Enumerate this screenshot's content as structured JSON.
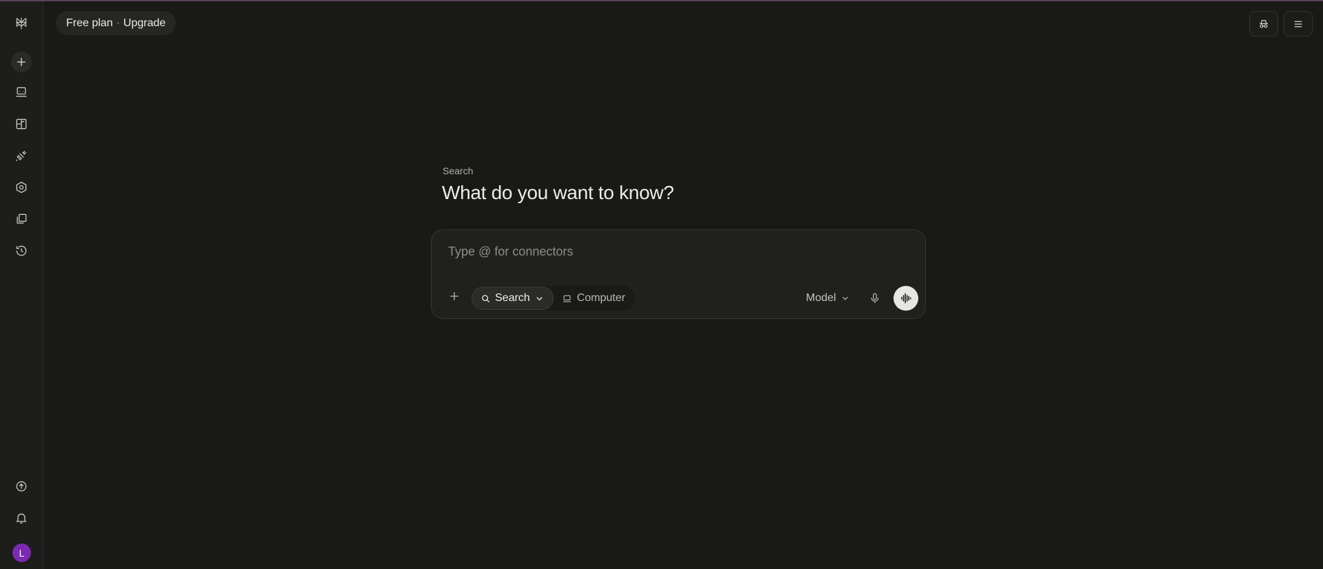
{
  "header": {
    "plan_label": "Free plan",
    "separator": "·",
    "upgrade_label": "Upgrade"
  },
  "main": {
    "mode_label": "Search",
    "headline": "What do you want to know?"
  },
  "composer": {
    "placeholder": "Type @ for connectors",
    "value": "",
    "modes": {
      "search_label": "Search",
      "computer_label": "Computer"
    },
    "model_label": "Model"
  },
  "user": {
    "avatar_initial": "L",
    "avatar_color": "#7a2bb0"
  },
  "icons": {
    "logo": "perplexity-logo-icon",
    "new": "plus-icon",
    "computer": "computer-icon",
    "spaces": "spaces-icon",
    "connectors": "plug-icon",
    "settings": "hexagon-icon",
    "library": "library-icon",
    "history": "history-icon",
    "upgrade": "arrow-up-circle-icon",
    "notifications": "bell-icon",
    "incognito": "incognito-icon",
    "menu": "menu-icon",
    "attach": "plus-icon",
    "search": "search-icon",
    "chevron": "chevron-down-icon",
    "mic": "mic-icon",
    "voice": "voice-wave-icon"
  },
  "colors": {
    "background": "#191918",
    "sidebar": "#1d1d1c",
    "accent_avatar": "#7a2bb0"
  }
}
